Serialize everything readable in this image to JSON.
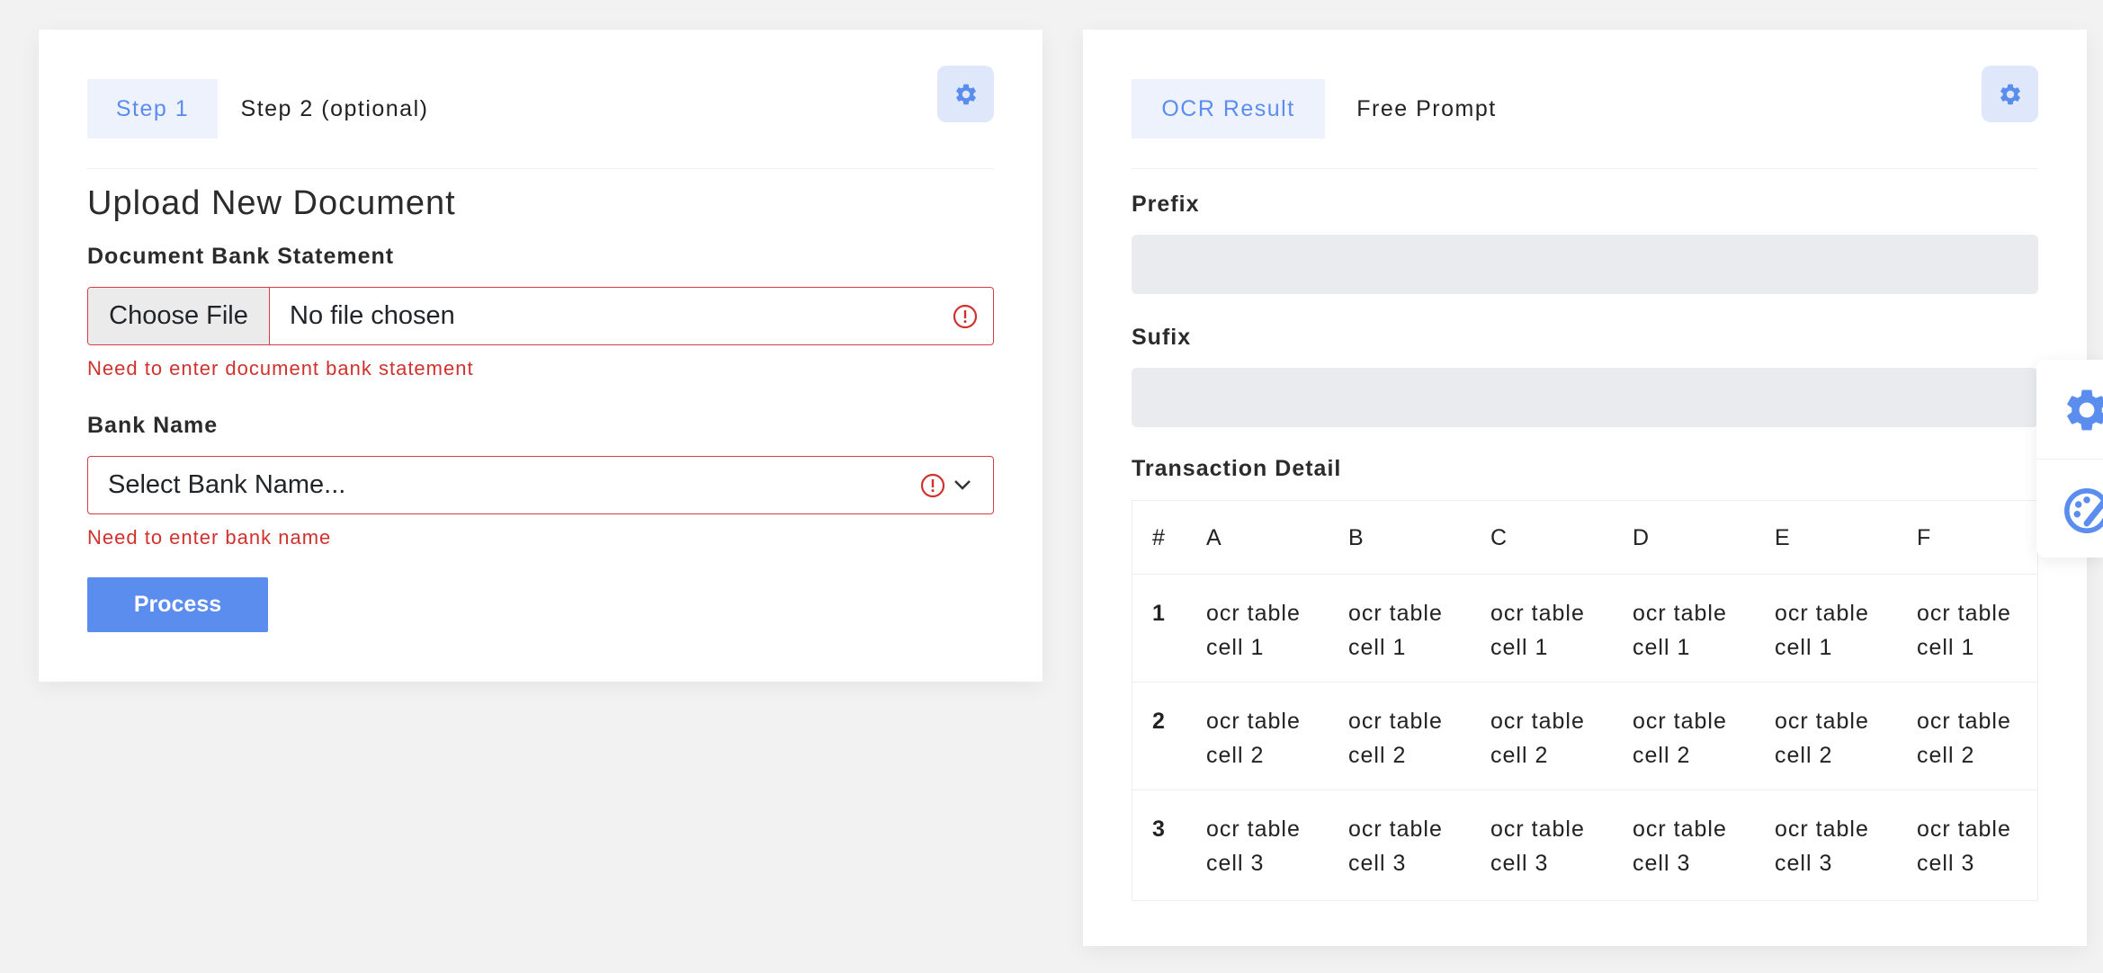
{
  "left_panel": {
    "tabs": [
      {
        "label": "Step 1",
        "active": true
      },
      {
        "label": "Step 2 (optional)",
        "active": false
      }
    ],
    "settings_icon": "gear-icon",
    "title": "Upload New Document",
    "document_field": {
      "label": "Document Bank Statement",
      "button_label": "Choose File",
      "value": "No file chosen",
      "error": "Need to enter document bank statement"
    },
    "bank_field": {
      "label": "Bank Name",
      "placeholder": "Select Bank Name...",
      "error": "Need to enter bank name"
    },
    "process_label": "Process"
  },
  "right_panel": {
    "tabs": [
      {
        "label": "OCR Result",
        "active": true
      },
      {
        "label": "Free Prompt",
        "active": false
      }
    ],
    "settings_icon": "gear-icon",
    "prefix_label": "Prefix",
    "prefix_value": "",
    "suffix_label": "Sufix",
    "suffix_value": "",
    "table_title": "Transaction Detail",
    "table": {
      "headers": [
        "#",
        "A",
        "B",
        "C",
        "D",
        "E",
        "F"
      ],
      "rows": [
        {
          "num": "1",
          "cells": [
            "ocr table cell 1",
            "ocr table cell 1",
            "ocr table cell 1",
            "ocr table cell 1",
            "ocr table cell 1",
            "ocr table cell 1"
          ]
        },
        {
          "num": "2",
          "cells": [
            "ocr table cell 2",
            "ocr table cell 2",
            "ocr table cell 2",
            "ocr table cell 2",
            "ocr table cell 2",
            "ocr table cell 2"
          ]
        },
        {
          "num": "3",
          "cells": [
            "ocr table cell 3",
            "ocr table cell 3",
            "ocr table cell 3",
            "ocr table cell 3",
            "ocr table cell 3",
            "ocr table cell 3"
          ]
        }
      ]
    }
  },
  "floating_toolbar": {
    "icons": [
      "gear-icon",
      "palette-icon"
    ]
  },
  "colors": {
    "accent": "#5b8def",
    "error": "#d0312d",
    "background": "#f2f2f2"
  }
}
